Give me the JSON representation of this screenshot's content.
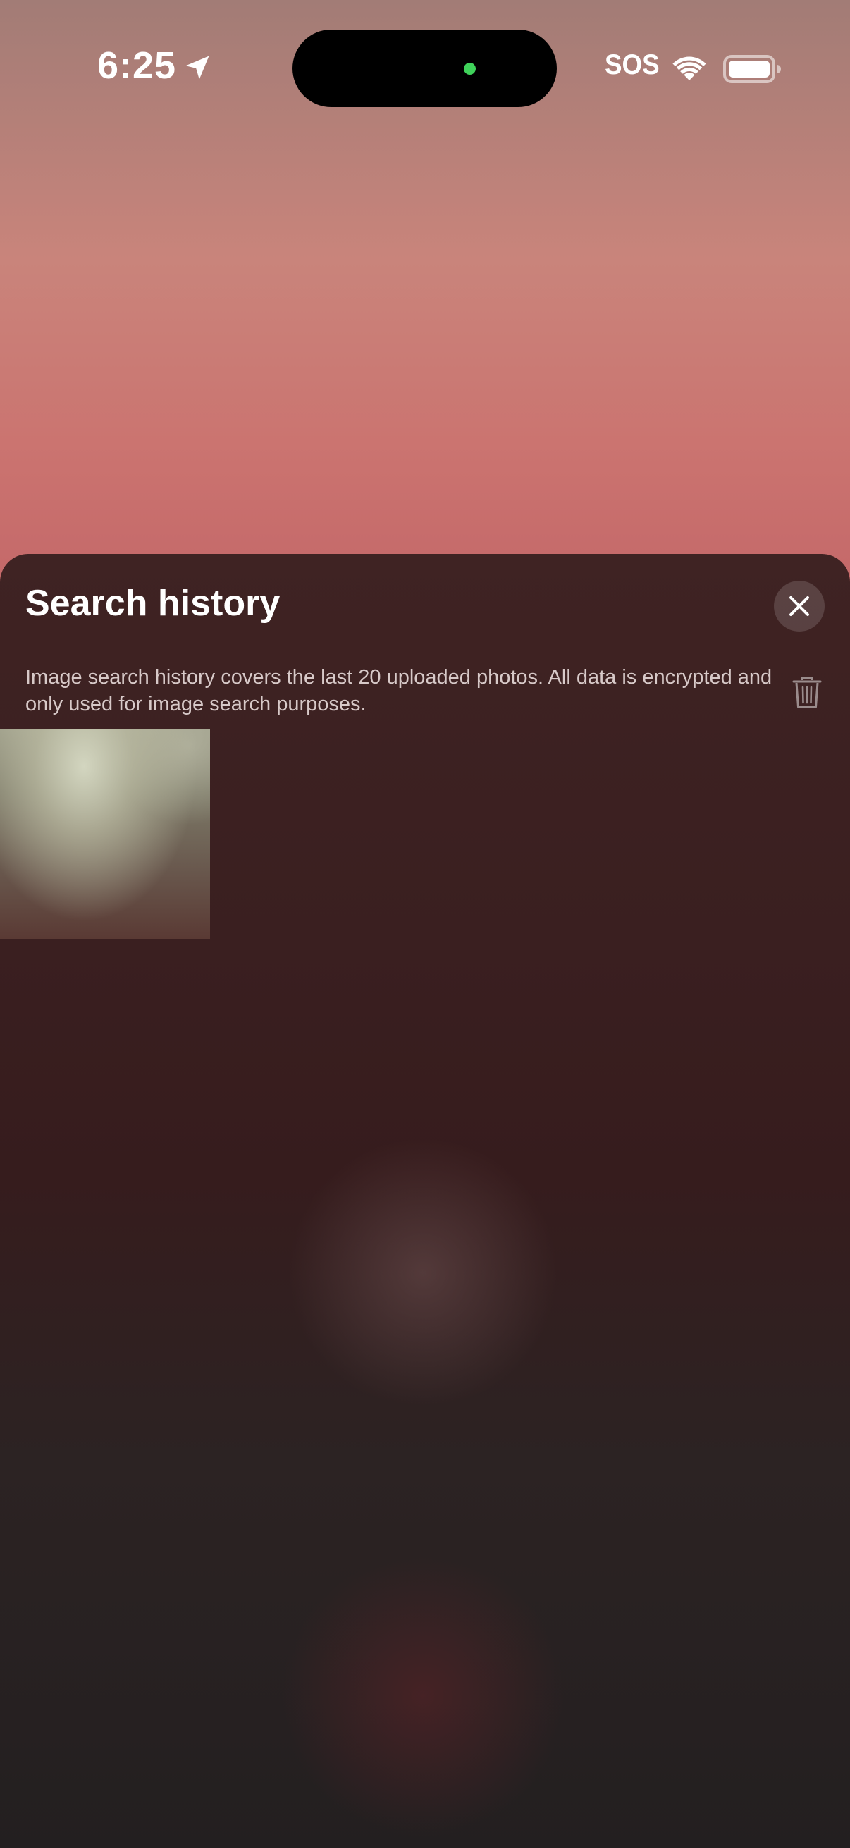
{
  "status_bar": {
    "time": "6:25",
    "sos": "SOS",
    "icons": [
      "location-arrow-icon",
      "wifi-icon",
      "battery-icon"
    ],
    "island_indicator_color": "#3fd25a"
  },
  "sheet": {
    "title": "Search history",
    "description": "Image search history covers the last 20 uploaded photos. All data is encrypted and only used for image search purposes.",
    "close_icon": "close-icon",
    "delete_icon": "trash-icon",
    "thumbnails": [
      {
        "name": "history-thumbnail-1"
      }
    ]
  },
  "colors": {
    "sheet_background": "#3a1f20",
    "title_text": "#ffffff",
    "description_text": "#d7c9c8"
  }
}
